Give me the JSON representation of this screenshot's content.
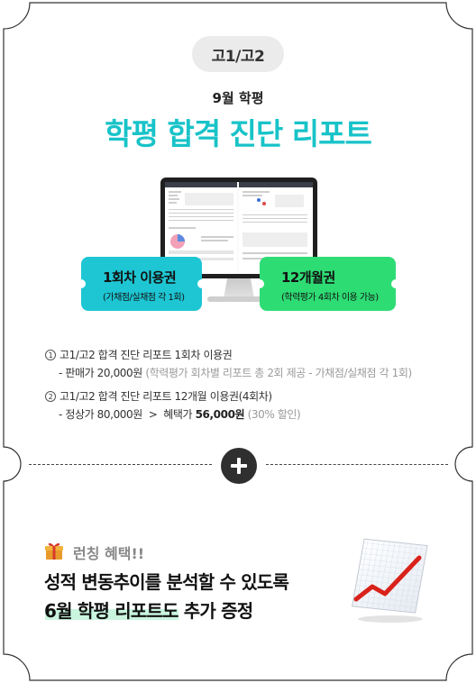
{
  "grade_badge": "고1/고2",
  "exam_subtitle": "9월 학평",
  "main_title": "학평 합격 진단 리포트",
  "tickets": [
    {
      "title": "1회차 이용권",
      "subtitle": "(가채점/실채점 각 1회)",
      "color": "#1ec6d3"
    },
    {
      "title": "12개월권",
      "subtitle": "(학력평가 4회차 이용 가능)",
      "color": "#2edc74"
    }
  ],
  "products": [
    {
      "num": "1",
      "name": "고1/고2 합격 진단 리포트 1회차 이용권",
      "price_label": "- 판매가 20,000원",
      "price_note": "(학력평가 회차별 리포트 총 2회 제공 - 가채점/실채점 각 1회)"
    },
    {
      "num": "2",
      "name": "고1/고2 합격 진단 리포트 12개월 이용권(4회차)",
      "list_price": "- 정상가 80,000원",
      "arrow": ">",
      "benefit_label": "혜택가",
      "benefit_price": "56,000원",
      "discount": "(30% 할인)"
    }
  ],
  "bonus": {
    "tag": "런칭 혜택!!",
    "line1": "성적 변동추이를 분석할 수 있도록",
    "line2": "6월 학평 리포트도 추가 증정"
  },
  "colors": {
    "accent_title": "#18c3c8",
    "ticket_cyan": "#1ec6d3",
    "ticket_green": "#2edc74",
    "highlight": "#c9f5df",
    "chart_line": "#d9221a"
  },
  "icons": [
    "plus-icon",
    "gift-icon",
    "growth-chart-icon",
    "monitor-icon"
  ]
}
